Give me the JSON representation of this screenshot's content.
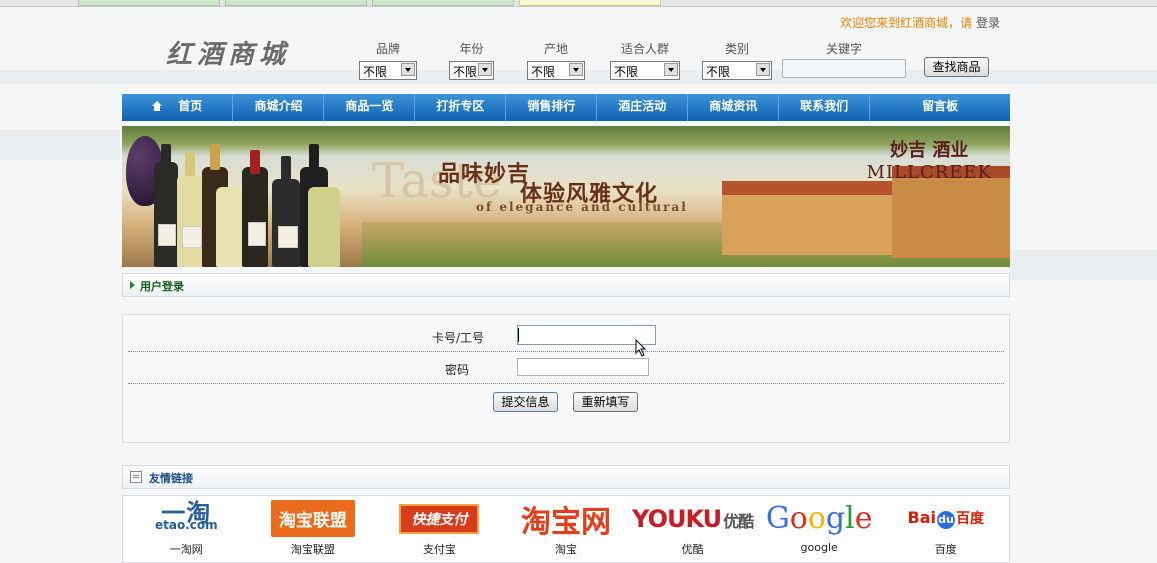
{
  "header": {
    "welcome_text": "欢迎您来到红酒商城，请",
    "login_link": "登录",
    "logo_text": "红酒商城"
  },
  "search": {
    "filters": [
      {
        "label": "品牌",
        "value": "不限"
      },
      {
        "label": "年份",
        "value": "不限"
      },
      {
        "label": "产地",
        "value": "不限"
      },
      {
        "label": "适合人群",
        "value": "不限"
      },
      {
        "label": "类别",
        "value": "不限"
      }
    ],
    "keyword_label": "关键字",
    "keyword_value": "",
    "search_button": "查找商品"
  },
  "nav": {
    "items": [
      "首页",
      "商城介绍",
      "商品一览",
      "打折专区",
      "销售排行",
      "酒庄活动",
      "商城资讯",
      "联系我们",
      "留言板"
    ]
  },
  "banner": {
    "headline_1": "品味妙吉",
    "headline_2": "体验风雅文化",
    "big_word": "Taste",
    "subtitle_en": "of elegance and cultural",
    "brand_cn": "妙吉 酒业",
    "brand_en": "MILLCREEK"
  },
  "login_section": {
    "title": "用户登录",
    "card_label": "卡号/工号",
    "card_value": "",
    "password_label": "密码",
    "password_value": "",
    "submit_button": "提交信息",
    "reset_button": "重新填写"
  },
  "links_section": {
    "title": "友情链接",
    "links": [
      {
        "name": "一淘网",
        "logo_text": "一淘",
        "logo_sub": "etao.com"
      },
      {
        "name": "淘宝联盟",
        "logo_text": "淘宝联盟"
      },
      {
        "name": "支付宝",
        "logo_text": "快捷支付"
      },
      {
        "name": "淘宝",
        "logo_text": "淘宝网"
      },
      {
        "name": "优酷",
        "logo_text": "YOUKU",
        "logo_sub": "优酷"
      },
      {
        "name": "google",
        "logo_text": "Google"
      },
      {
        "name": "百度",
        "logo_text": "Bai",
        "logo_mid": "du",
        "logo_sub": "百度"
      }
    ]
  }
}
